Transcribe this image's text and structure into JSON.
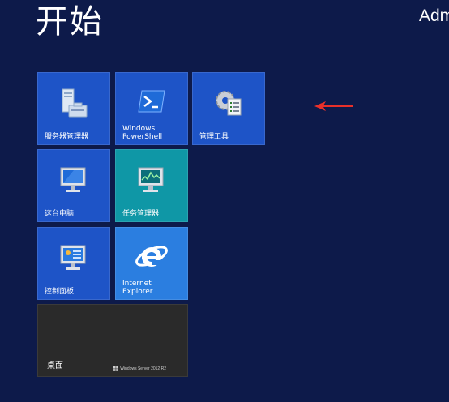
{
  "header": {
    "title": "开始",
    "user": "Adm"
  },
  "tiles": [
    {
      "label": "服务器管理器"
    },
    {
      "label": "Windows\nPowerShell"
    },
    {
      "label": "管理工具"
    },
    {
      "label": "这台电脑"
    },
    {
      "label": "任务管理器"
    },
    {
      "label": "控制面板"
    },
    {
      "label": "Internet\nExplorer"
    },
    {
      "label": "桌面",
      "brand": "Windows Server 2012 R2"
    }
  ],
  "colors": {
    "background": "#0d1a4a",
    "tile_blue": "#1e54c7",
    "tile_teal": "#0f97a6",
    "tile_ie": "#2b7ee0",
    "tile_desktop": "#2a2a2a",
    "annotation_arrow": "#e8302a"
  }
}
